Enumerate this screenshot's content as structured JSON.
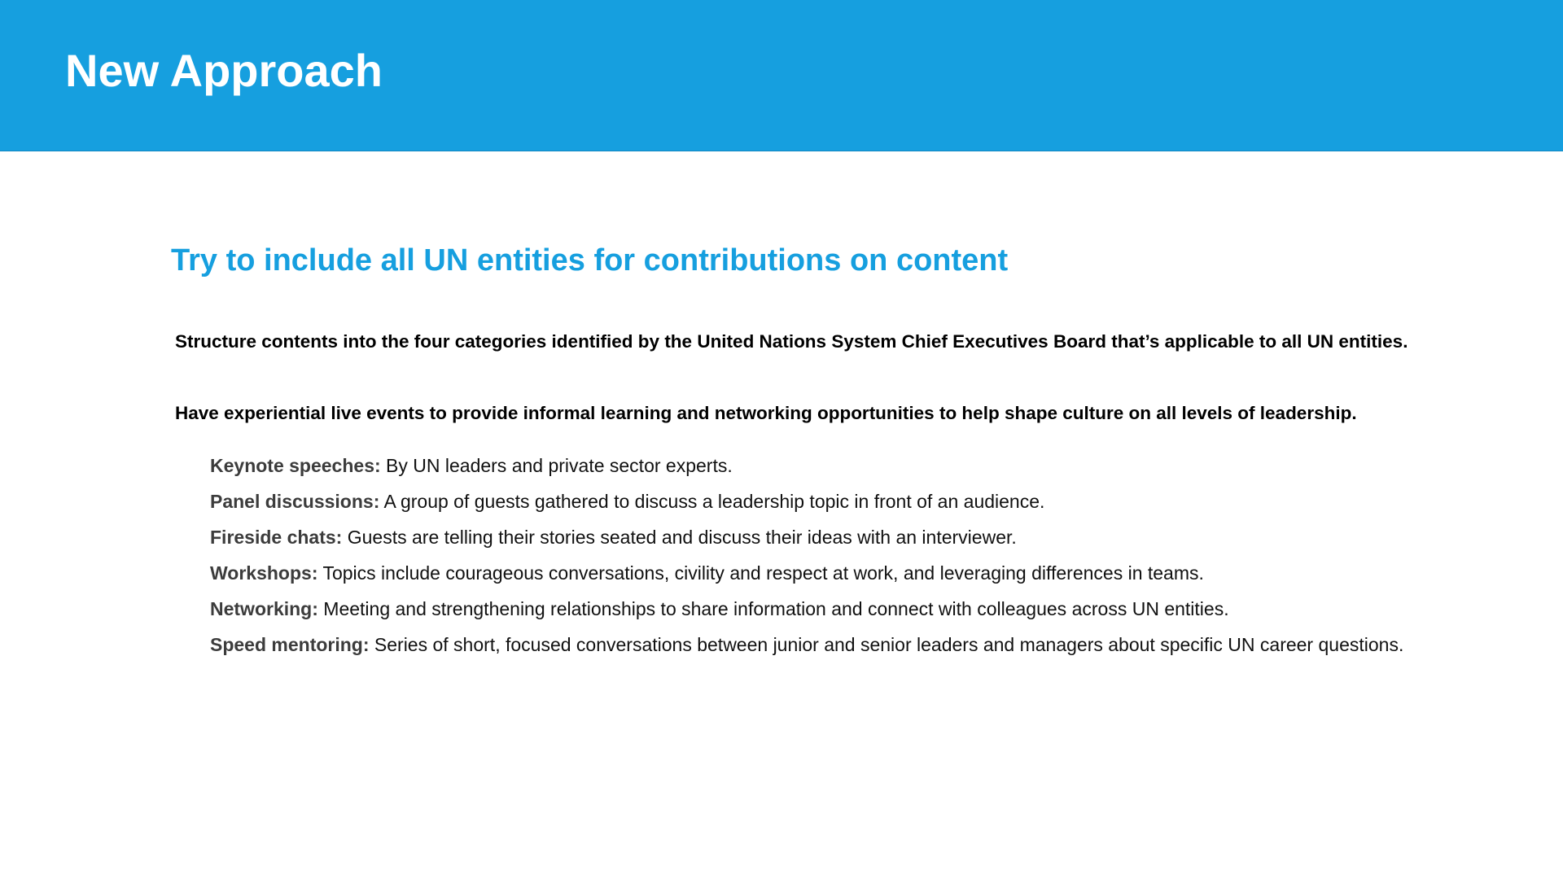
{
  "header": {
    "title": "New Approach",
    "color": "#169fdf"
  },
  "main": {
    "subtitle": "Try to include all UN entities for contributions on content",
    "paragraphs": [
      "Structure contents into the four categories identified by the United Nations System Chief Executives Board that’s applicable to all UN entities.",
      "Have experiential live events to provide informal learning and networking opportunities to help shape culture on all levels of leadership."
    ],
    "events": [
      {
        "term": "Keynote speeches:",
        "description": "By UN leaders and private sector experts."
      },
      {
        "term": "Panel discussions:",
        "description": "A group of guests gathered to discuss a leadership topic in front of an audience."
      },
      {
        "term": "Fireside chats:",
        "description": "Guests are telling their stories seated and discuss their ideas with an interviewer."
      },
      {
        "term": "Workshops:",
        "description": "Topics include courageous conversations, civility and respect at work, and leveraging differences in teams."
      },
      {
        "term": "Networking:",
        "description": "Meeting and strengthening relationships to share information and connect with colleagues across UN entities."
      },
      {
        "term": "Speed mentoring:",
        "description": "Series of short, focused conversations between junior and senior leaders and managers about specific UN career questions."
      }
    ]
  }
}
